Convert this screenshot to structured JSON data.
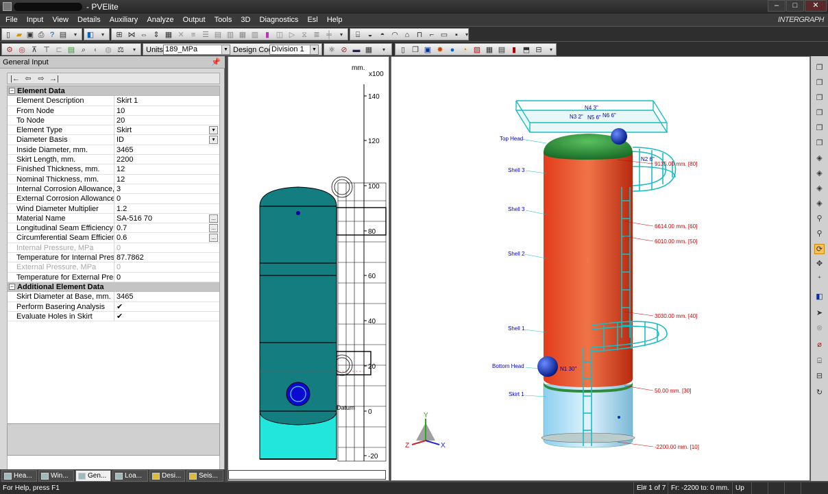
{
  "window": {
    "title": "- PVElite",
    "min_label": "–",
    "max_label": "□",
    "close_label": "✕"
  },
  "brand": "INTERGRAPH",
  "menu": [
    "File",
    "Input",
    "View",
    "Details",
    "Auxiliary",
    "Analyze",
    "Output",
    "Tools",
    "3D",
    "Diagnostics",
    "Esl",
    "Help"
  ],
  "toolbar": {
    "units_label": "Units",
    "units_value": "189_MPa",
    "design_code_label": "Design Code",
    "design_code_value": "Division 1"
  },
  "panel": {
    "title": "General Input",
    "pin_icon": "pin-icon",
    "nav_buttons": [
      "first-icon",
      "prev-icon",
      "next-icon",
      "last-icon"
    ],
    "element_data_title": "Element Data",
    "additional_title": "Additional Element Data",
    "rows": [
      {
        "label": "Element Description",
        "value": "Skirt 1"
      },
      {
        "label": "From Node",
        "value": "10"
      },
      {
        "label": "To Node",
        "value": "20"
      },
      {
        "label": "Element Type",
        "value": "Skirt"
      },
      {
        "label": "Diameter Basis",
        "value": "ID"
      },
      {
        "label": "Inside Diameter, mm.",
        "value": "3465"
      },
      {
        "label": "Skirt Length, mm.",
        "value": "2200"
      },
      {
        "label": "Finished Thickness, mm.",
        "value": "12"
      },
      {
        "label": "Nominal Thickness,  mm.",
        "value": "12"
      },
      {
        "label": "Internal Corrosion Allowance,  mm.",
        "value": "3"
      },
      {
        "label": "External Corrosion Allowance,  mm.",
        "value": "0"
      },
      {
        "label": "Wind Diameter Multiplier",
        "value": "1.2"
      },
      {
        "label": "Material Name",
        "value": "SA-516 70"
      },
      {
        "label": "Longitudinal Seam Efficiency",
        "value": "0.7"
      },
      {
        "label": "Circumferential Seam Efficiency",
        "value": "0.6"
      },
      {
        "label": "Internal Pressure,  MPa",
        "value": "0"
      },
      {
        "label": "Temperature for Internal Pressure, C",
        "value": "87.7862"
      },
      {
        "label": "External Pressure,  MPa",
        "value": "0"
      },
      {
        "label": "Temperature for External Pressure, C",
        "value": "0"
      }
    ],
    "additional_rows": [
      {
        "label": "Skirt Diameter at Base, mm.",
        "value": "3465"
      },
      {
        "label": "Perform Basering Analysis",
        "value": "✔"
      },
      {
        "label": "Evaluate Holes in Skirt",
        "value": "✔"
      }
    ],
    "dropdown_glyph": "▾",
    "more_glyph": "..."
  },
  "tabs": [
    {
      "label": "Hea...",
      "icon": "heading-icon"
    },
    {
      "label": "Win...",
      "icon": "wind-icon"
    },
    {
      "label": "Gen...",
      "icon": "general-icon"
    },
    {
      "label": "Loa...",
      "icon": "load-icon"
    },
    {
      "label": "Desi...",
      "icon": "design-icon"
    },
    {
      "label": "Seis...",
      "icon": "seismic-icon"
    }
  ],
  "view2d": {
    "units": "mm.",
    "scale": "x100",
    "ticks": [
      "140",
      "120",
      "100",
      "80",
      "60",
      "40",
      "20",
      "0",
      "-20"
    ],
    "datum": "Datum"
  },
  "view3d": {
    "labels": [
      "Top Head",
      "Shell 3",
      "Shell 3",
      "Shell 2",
      "Shell 1",
      "Bottom Head",
      "Skirt 1"
    ],
    "dims": [
      "9135.00 mm.  [80]",
      "6614.00 mm.  [60]",
      "6010.00 mm.  [50]",
      "3030.00 mm.  [40]",
      "50.00 mm.  [30]",
      "-2200.00 mm.  [10]"
    ],
    "nozzles": [
      "N4 3\"",
      "N3 2\"",
      "N5 6\"",
      "N6 6\"",
      "N2 6\"",
      "N1 30\""
    ],
    "axes": {
      "x": "X",
      "y": "Y",
      "z": "Z"
    }
  },
  "status": {
    "help": "For Help, press F1",
    "element": "El# 1 of 7",
    "range": "Fr: -2200 to: 0 mm.",
    "direction": "Up"
  }
}
